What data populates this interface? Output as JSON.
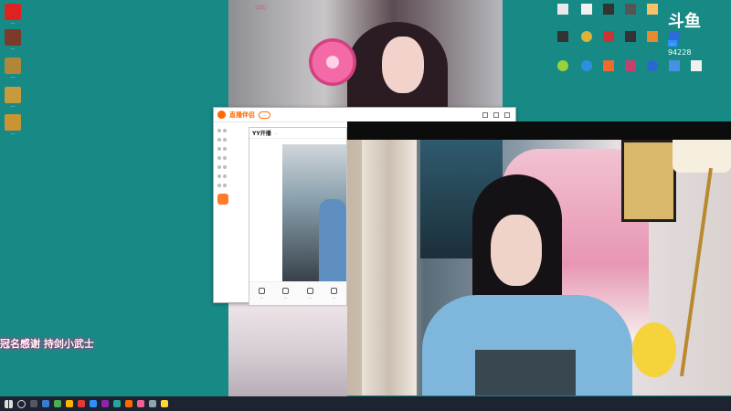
{
  "desktop_left": [
    {
      "label": "..."
    },
    {
      "label": "..."
    },
    {
      "label": "..."
    },
    {
      "label": "..."
    },
    {
      "label": "..."
    }
  ],
  "stream_top": {
    "title": "..."
  },
  "live_tool": {
    "brand": "直播伴侣",
    "badge": "..."
  },
  "yy_window": {
    "logo": "YY开播",
    "meta": "...",
    "tools": [
      {
        "label": "..."
      },
      {
        "label": "..."
      },
      {
        "label": "..."
      },
      {
        "label": "..."
      }
    ]
  },
  "banner": {
    "text": "冠名感谢 持剑小武士"
  },
  "logo": {
    "main": "斗鱼",
    "tag": "...",
    "number": "94228"
  },
  "colors": {
    "desktop": "#178a86",
    "banner_glow": "#ff4da6",
    "taskbar": "#1d2330"
  }
}
